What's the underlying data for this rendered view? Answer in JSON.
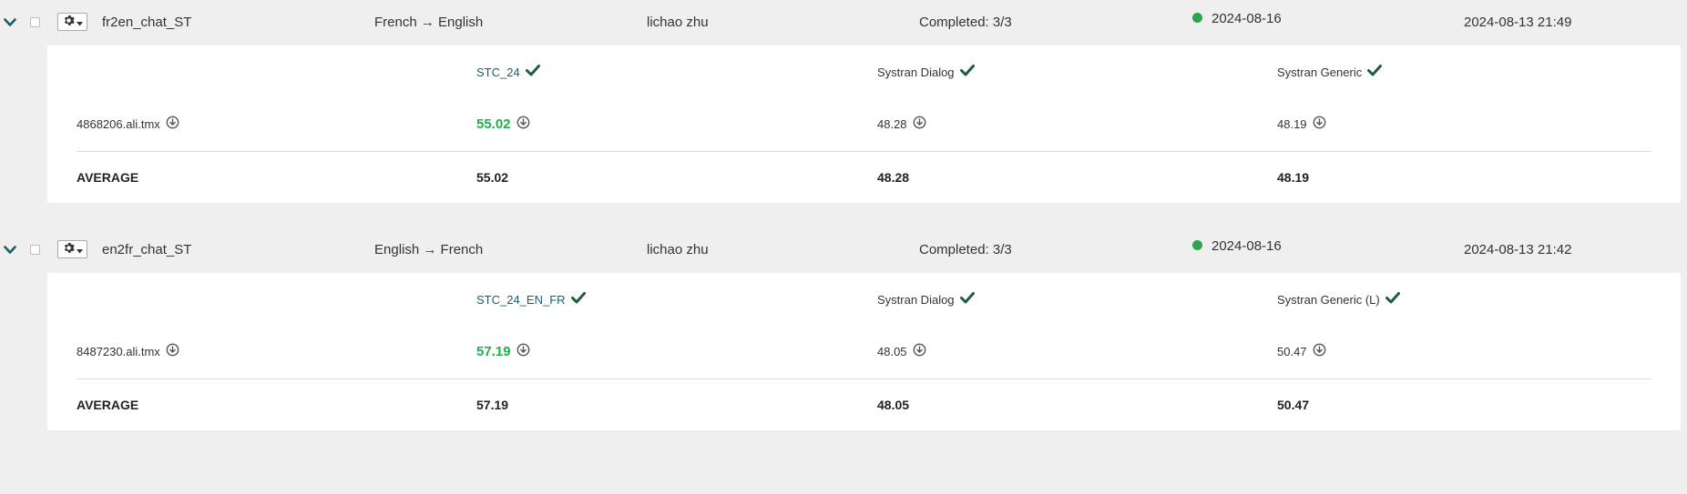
{
  "jobs": [
    {
      "name": "fr2en_chat_ST",
      "lang_pair": "French → English",
      "owner": "lichao zhu",
      "status": "Completed: 3/3",
      "status_date": "2024-08-16",
      "created": "2024-08-13 21:49",
      "file": "4868206.ali.tmx",
      "engines": [
        "STC_24",
        "Systran Dialog",
        "Systran Generic"
      ],
      "scores": [
        "55.02",
        "48.28",
        "48.19"
      ],
      "average_label": "AVERAGE",
      "averages": [
        "55.02",
        "48.28",
        "48.19"
      ]
    },
    {
      "name": "en2fr_chat_ST",
      "lang_pair": "English → French",
      "owner": "lichao zhu",
      "status": "Completed: 3/3",
      "status_date": "2024-08-16",
      "created": "2024-08-13 21:42",
      "file": "8487230.ali.tmx",
      "engines": [
        "STC_24_EN_FR",
        "Systran Dialog",
        "Systran Generic (L)"
      ],
      "scores": [
        "57.19",
        "48.05",
        "50.47"
      ],
      "average_label": "AVERAGE",
      "averages": [
        "57.19",
        "48.05",
        "50.47"
      ]
    }
  ],
  "colors": {
    "status_dot": "#2ea44f",
    "best_score": "#22b04b",
    "check": "#1e5e3e",
    "chevron": "#1a5e6b"
  },
  "icons": {
    "expand": "chevron-down-icon",
    "settings": "gear-icon",
    "done": "check-icon",
    "download": "download-icon"
  }
}
